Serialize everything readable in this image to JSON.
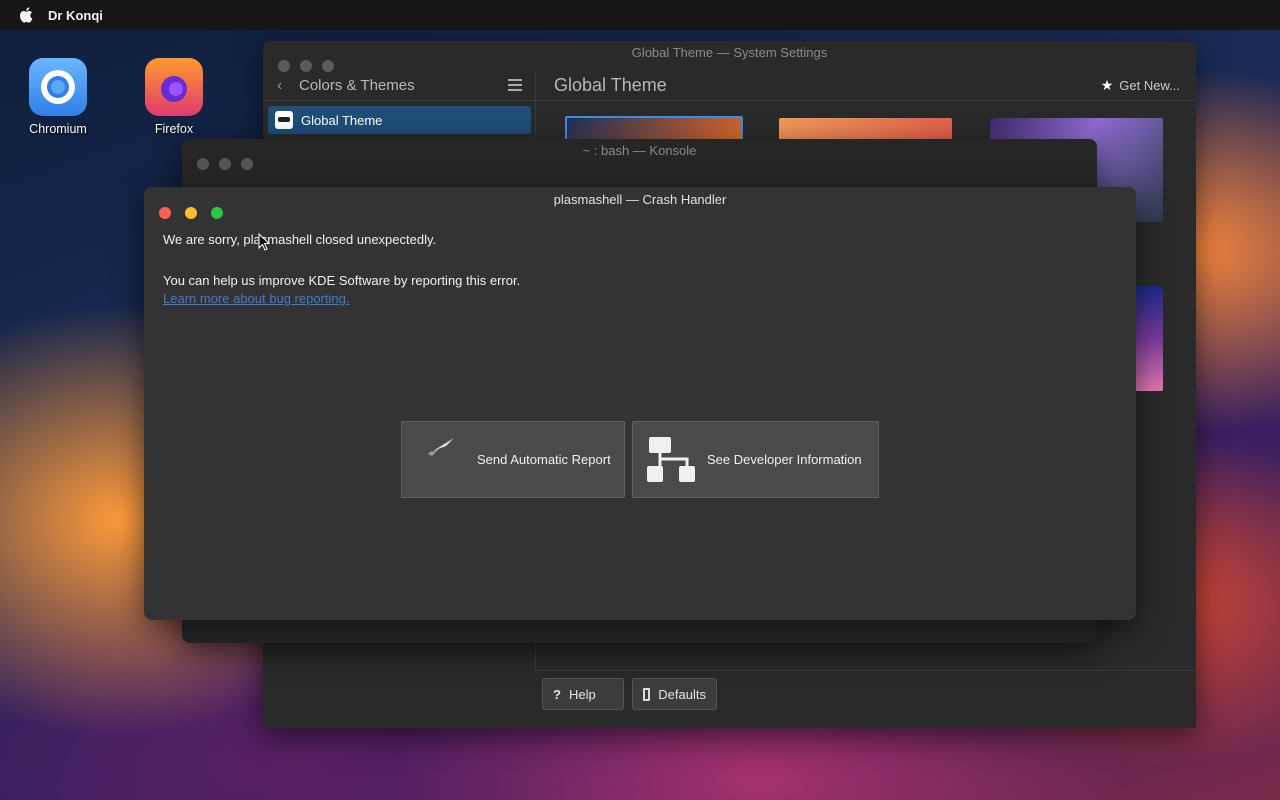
{
  "menubar": {
    "app_name": "Dr Konqi"
  },
  "desktop": {
    "icons": [
      {
        "label": "Chromium"
      },
      {
        "label": "Firefox"
      }
    ]
  },
  "settings_window": {
    "title": "Global Theme — System Settings",
    "breadcrumb": "Colors & Themes",
    "page_heading": "Global Theme",
    "get_new_label": "Get New...",
    "sidebar_selected": "Global Theme",
    "footer": {
      "help_label": "Help",
      "defaults_label": "Defaults"
    }
  },
  "konsole_window": {
    "title": "~ : bash — Konsole"
  },
  "crash_handler": {
    "title": "plasmashell — Crash Handler",
    "message": "We are sorry, plasmashell closed unexpectedly.",
    "help_text": "You can help us improve KDE Software by reporting this error.",
    "learn_more_link": "Learn more about bug reporting.",
    "send_report_label": "Send Automatic Report",
    "developer_info_label": "See Developer Information"
  },
  "colors": {
    "traffic_close": "#ff5f57",
    "traffic_minimize": "#febc2e",
    "traffic_maximize": "#28c840",
    "selection": "#1f4e78",
    "link": "#3e7bd6"
  }
}
